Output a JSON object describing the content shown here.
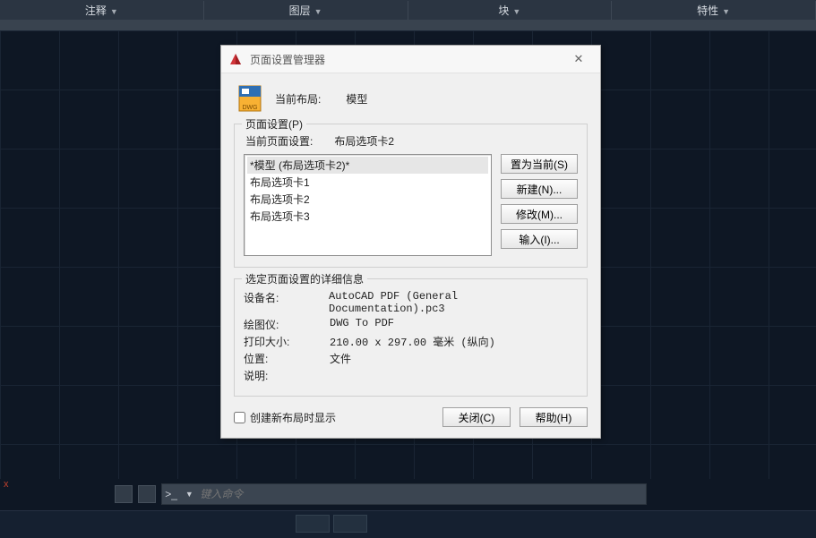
{
  "ribbon": {
    "tabs": [
      "注释",
      "图层",
      "块",
      "特性"
    ]
  },
  "command_bar": {
    "placeholder": "键入命令"
  },
  "dialog": {
    "title": "页面设置管理器",
    "current_layout_label": "当前布局:",
    "current_layout_value": "模型",
    "page_setup_group": {
      "legend": "页面设置(P)",
      "current_ps_label": "当前页面设置:",
      "current_ps_value": "布局选项卡2",
      "items": [
        "*模型 (布局选项卡2)*",
        "布局选项卡1",
        "布局选项卡2",
        "布局选项卡3"
      ],
      "buttons": {
        "set_current": "置为当前(S)",
        "new": "新建(N)...",
        "modify": "修改(M)...",
        "import": "输入(I)..."
      }
    },
    "details_group": {
      "legend": "选定页面设置的详细信息",
      "rows": {
        "device_label": "设备名:",
        "device_value": "AutoCAD PDF (General Documentation).pc3",
        "plotter_label": "绘图仪:",
        "plotter_value": "DWG To PDF",
        "size_label": "打印大小:",
        "size_value": "210.00 x 297.00 毫米 (纵向)",
        "where_label": "位置:",
        "where_value": "文件",
        "desc_label": "说明:",
        "desc_value": ""
      }
    },
    "footer": {
      "checkbox_label": "创建新布局时显示",
      "close": "关闭(C)",
      "help": "帮助(H)"
    }
  }
}
